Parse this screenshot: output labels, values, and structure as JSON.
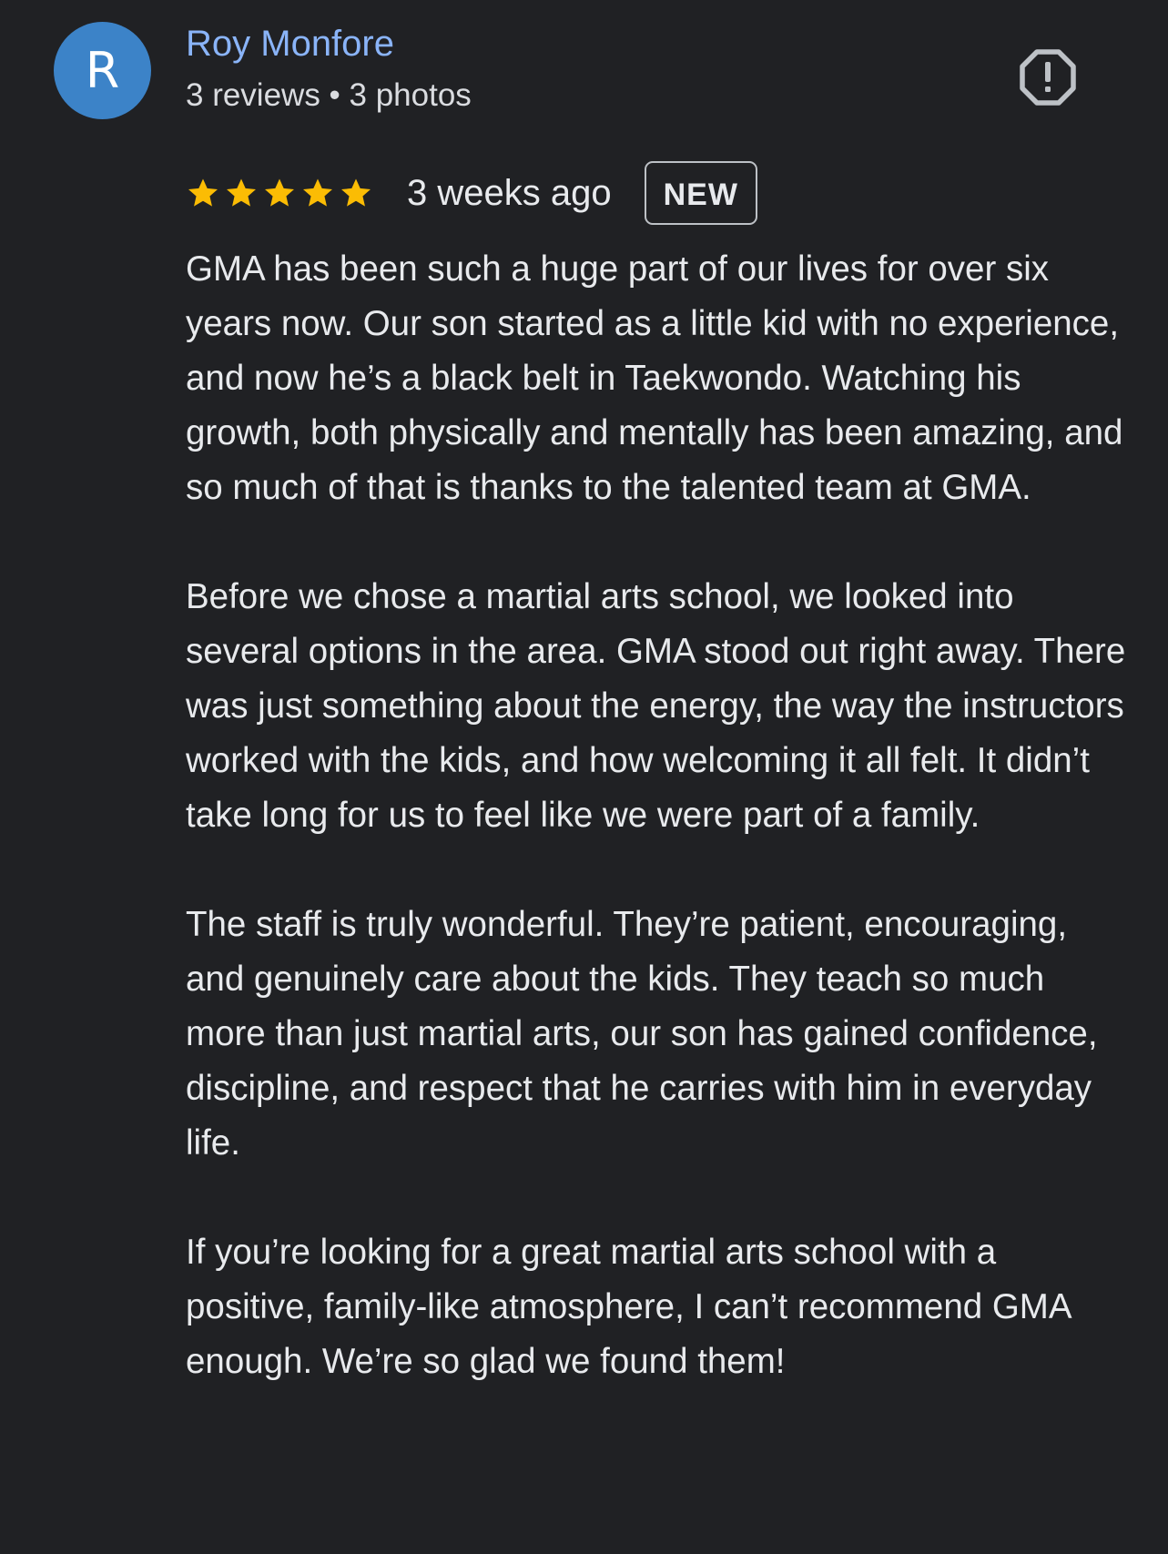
{
  "review": {
    "author": {
      "initial": "R",
      "name": "Roy Monfore",
      "meta": "3 reviews • 3 photos",
      "avatar_color": "#3c83c8"
    },
    "report_icon": "report-flag-icon",
    "rating": {
      "stars": 5,
      "max": 5,
      "star_color": "#fbbc04"
    },
    "date": "3 weeks ago",
    "badge": "NEW",
    "paragraphs": [
      "GMA has been such a huge part of our lives for over six years now. Our son started as a little kid with no experience, and now he’s a black belt in Taekwondo. Watching his growth, both physically and mentally has been amazing, and so much of that is thanks to the talented team at GMA.",
      "Before we chose a martial arts school, we looked into several options in the area. GMA stood out right away. There was just something about the energy, the way the instructors worked with the kids, and how welcoming it all felt. It didn’t take long for us to feel like we were part of a family.",
      "The staff is truly wonderful. They’re patient, encouraging, and genuinely care about the kids. They teach so much more than just martial arts, our son has gained confidence, discipline, and respect that he carries with him in everyday life.",
      "If you’re looking for a great martial arts school with a positive, family-like atmosphere, I can’t recommend GMA enough. We’re so glad we found them!"
    ]
  }
}
